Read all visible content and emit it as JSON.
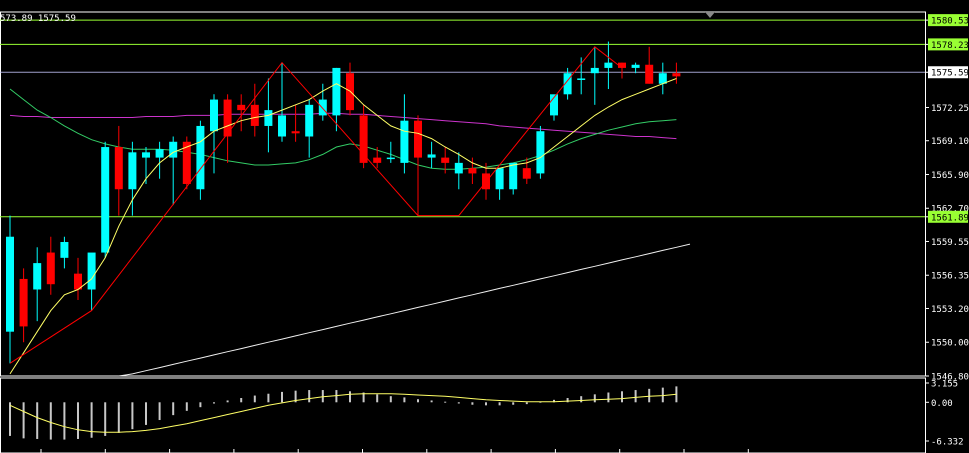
{
  "header": {
    "symbol_prices": "573.89 1575.59"
  },
  "colors": {
    "background": "#000000",
    "bull": "#00ffff",
    "bear": "#ff0000",
    "ma_fast": "#ffff66",
    "ma_mid": "#33cc66",
    "ma_slow": "#cc33cc",
    "ma_long": "#f0f0f0",
    "hline": "#99ff33",
    "zigzag": "#ff0000",
    "current_line": "#c9c9ff"
  },
  "chart_data": {
    "type": "candlestick",
    "price_axis_ticks": [
      "1580.53",
      "1578.23",
      "1575.59",
      "1572.25",
      "1569.10",
      "1565.90",
      "1562.70",
      "1561.89",
      "1559.55",
      "1556.35",
      "1553.20",
      "1550.00",
      "1546.80"
    ],
    "ylim": [
      1546.8,
      1581.3
    ],
    "hlines": [
      {
        "value": 1580.53,
        "label": "1580.53"
      },
      {
        "value": 1578.23,
        "label": "1578.23"
      },
      {
        "value": 1561.89,
        "label": "1561.89"
      }
    ],
    "current_price": {
      "value": 1575.59,
      "label": "1575.59"
    },
    "ohlc": [
      [
        1551.0,
        1562.0,
        1548.0,
        1560.0
      ],
      [
        1556.0,
        1557.0,
        1550.0,
        1551.5
      ],
      [
        1555.0,
        1559.0,
        1552.0,
        1557.5
      ],
      [
        1558.5,
        1560.0,
        1554.5,
        1555.5
      ],
      [
        1558.0,
        1560.0,
        1557.0,
        1559.5
      ],
      [
        1556.5,
        1558.0,
        1554.0,
        1555.0
      ],
      [
        1555.0,
        1558.0,
        1553.0,
        1558.5
      ],
      [
        1558.5,
        1569.0,
        1558.0,
        1568.5
      ],
      [
        1568.5,
        1570.5,
        1562.0,
        1564.5
      ],
      [
        1564.5,
        1569.0,
        1562.0,
        1568.0
      ],
      [
        1567.5,
        1568.5,
        1565.0,
        1568.0
      ],
      [
        1567.5,
        1569.0,
        1565.5,
        1568.3
      ],
      [
        1567.5,
        1569.5,
        1563.0,
        1569.0
      ],
      [
        1569.0,
        1569.5,
        1564.5,
        1565.0
      ],
      [
        1564.5,
        1571.0,
        1563.5,
        1570.5
      ],
      [
        1570.0,
        1573.5,
        1566.0,
        1573.0
      ],
      [
        1573.0,
        1573.5,
        1567.0,
        1569.5
      ],
      [
        1572.5,
        1573.5,
        1570.0,
        1572.0
      ],
      [
        1572.5,
        1574.5,
        1569.5,
        1570.5
      ],
      [
        1570.5,
        1575.0,
        1568.0,
        1572.0
      ],
      [
        1569.5,
        1576.5,
        1569.0,
        1571.5
      ],
      [
        1570.0,
        1572.5,
        1569.0,
        1569.8
      ],
      [
        1569.5,
        1573.0,
        1567.5,
        1572.5
      ],
      [
        1571.5,
        1574.5,
        1571.0,
        1573.0
      ],
      [
        1571.5,
        1576.0,
        1570.0,
        1576.0
      ],
      [
        1575.5,
        1576.5,
        1571.5,
        1572.0
      ],
      [
        1571.5,
        1572.5,
        1566.5,
        1567.0
      ],
      [
        1567.5,
        1568.5,
        1566.5,
        1567.0
      ],
      [
        1567.5,
        1569.0,
        1567.0,
        1567.5
      ],
      [
        1567.0,
        1573.5,
        1566.0,
        1571.0
      ],
      [
        1571.0,
        1571.5,
        1562.0,
        1567.5
      ],
      [
        1567.5,
        1569.0,
        1566.5,
        1567.8
      ],
      [
        1567.5,
        1568.5,
        1566.0,
        1567.0
      ],
      [
        1566.0,
        1568.0,
        1564.5,
        1567.0
      ],
      [
        1566.5,
        1567.5,
        1565.0,
        1566.0
      ],
      [
        1566.0,
        1567.0,
        1563.5,
        1564.5
      ],
      [
        1564.5,
        1566.5,
        1563.5,
        1566.5
      ],
      [
        1564.5,
        1567.0,
        1564.0,
        1567.0
      ],
      [
        1566.5,
        1567.5,
        1565.0,
        1565.5
      ],
      [
        1566.0,
        1570.5,
        1565.5,
        1570.0
      ],
      [
        1571.5,
        1573.0,
        1571.0,
        1573.5
      ],
      [
        1573.5,
        1576.0,
        1573.0,
        1575.5
      ],
      [
        1575.0,
        1577.0,
        1573.5,
        1575.0
      ],
      [
        1575.5,
        1578.0,
        1572.5,
        1576.0
      ],
      [
        1576.0,
        1578.5,
        1574.0,
        1576.5
      ],
      [
        1576.5,
        1576.5,
        1575.0,
        1576.0
      ],
      [
        1576.0,
        1576.5,
        1575.5,
        1576.3
      ],
      [
        1576.3,
        1578.0,
        1574.5,
        1574.5
      ],
      [
        1574.5,
        1576.5,
        1573.5,
        1575.5
      ],
      [
        1575.5,
        1576.5,
        1574.5,
        1575.2
      ]
    ],
    "ma_fast": [
      1547.0,
      1549.0,
      1551.0,
      1553.0,
      1554.5,
      1555.0,
      1556.0,
      1558.0,
      1561.0,
      1563.5,
      1565.5,
      1567.0,
      1568.0,
      1568.5,
      1569.0,
      1570.0,
      1570.5,
      1571.0,
      1571.3,
      1571.5,
      1572.0,
      1572.5,
      1573.0,
      1573.8,
      1574.5,
      1573.8,
      1572.5,
      1571.5,
      1570.5,
      1570.0,
      1569.8,
      1569.3,
      1568.5,
      1567.8,
      1567.0,
      1566.5,
      1566.5,
      1566.8,
      1567.0,
      1567.5,
      1568.5,
      1569.5,
      1570.5,
      1571.5,
      1572.3,
      1573.0,
      1573.5,
      1574.0,
      1574.5,
      1575.0
    ],
    "ma_mid": [
      1574.0,
      1573.0,
      1572.0,
      1571.3,
      1570.5,
      1569.8,
      1569.2,
      1568.8,
      1568.5,
      1568.3,
      1568.3,
      1568.3,
      1568.2,
      1568.0,
      1567.8,
      1567.5,
      1567.2,
      1567.0,
      1566.8,
      1566.8,
      1566.9,
      1567.0,
      1567.3,
      1567.8,
      1568.5,
      1568.8,
      1568.6,
      1568.2,
      1567.8,
      1567.3,
      1566.8,
      1566.5,
      1566.4,
      1566.4,
      1566.5,
      1566.6,
      1566.8,
      1567.0,
      1567.3,
      1567.7,
      1568.2,
      1568.8,
      1569.3,
      1569.7,
      1570.1,
      1570.4,
      1570.7,
      1570.9,
      1571.0,
      1571.1
    ],
    "ma_slow": [
      1571.5,
      1571.4,
      1571.4,
      1571.3,
      1571.3,
      1571.3,
      1571.3,
      1571.3,
      1571.3,
      1571.3,
      1571.4,
      1571.4,
      1571.4,
      1571.5,
      1571.5,
      1571.5,
      1571.6,
      1571.6,
      1571.6,
      1571.6,
      1571.6,
      1571.6,
      1571.6,
      1571.7,
      1571.7,
      1571.6,
      1571.6,
      1571.5,
      1571.4,
      1571.3,
      1571.2,
      1571.1,
      1571.0,
      1570.9,
      1570.8,
      1570.7,
      1570.5,
      1570.4,
      1570.3,
      1570.2,
      1570.1,
      1570.0,
      1569.9,
      1569.8,
      1569.7,
      1569.6,
      1569.5,
      1569.5,
      1569.4,
      1569.3
    ],
    "ma_long": {
      "start_index": 8,
      "values": [
        1546.8,
        1547.0,
        1547.3,
        1547.6,
        1547.9,
        1548.2,
        1548.5,
        1548.8,
        1549.1,
        1549.4,
        1549.7,
        1550.0,
        1550.3,
        1550.6,
        1550.9,
        1551.2,
        1551.5,
        1551.8,
        1552.1,
        1552.4,
        1552.7,
        1553.0,
        1553.3,
        1553.6,
        1553.9,
        1554.2,
        1554.5,
        1554.8,
        1555.1,
        1555.4,
        1555.7,
        1556.0,
        1556.3,
        1556.6,
        1556.9,
        1557.2,
        1557.5,
        1557.8,
        1558.1,
        1558.4,
        1558.7,
        1559.0,
        1559.3
      ]
    },
    "zigzag": [
      [
        0,
        1548.0
      ],
      [
        6,
        1553.0
      ],
      [
        20,
        1576.5
      ],
      [
        30,
        1562.0
      ],
      [
        33,
        1562.0
      ],
      [
        43,
        1578.0
      ],
      [
        45,
        1576.0
      ]
    ],
    "oscillator": {
      "ticks": [
        "3.155",
        "0.00",
        "-6.332"
      ],
      "ylim": [
        -6.332,
        3.155
      ],
      "histogram": [
        -5.5,
        -5.9,
        -6.0,
        -6.1,
        -6.1,
        -6.0,
        -5.8,
        -5.5,
        -5.0,
        -4.4,
        -3.7,
        -2.9,
        -2.1,
        -1.4,
        -0.8,
        -0.2,
        0.3,
        0.7,
        1.1,
        1.4,
        1.7,
        1.9,
        2.0,
        2.0,
        2.0,
        1.8,
        1.6,
        1.3,
        1.0,
        0.8,
        0.5,
        0.3,
        0.1,
        -0.2,
        -0.4,
        -0.5,
        -0.5,
        -0.4,
        -0.3,
        0.1,
        0.4,
        0.7,
        1.0,
        1.3,
        1.6,
        1.8,
        2.0,
        2.2,
        2.4,
        2.6
      ],
      "signal": [
        -0.5,
        -1.5,
        -2.5,
        -3.3,
        -4.0,
        -4.5,
        -4.8,
        -4.9,
        -4.9,
        -4.8,
        -4.6,
        -4.3,
        -3.9,
        -3.5,
        -3.0,
        -2.5,
        -2.0,
        -1.5,
        -1.0,
        -0.5,
        -0.1,
        0.3,
        0.6,
        0.9,
        1.1,
        1.3,
        1.4,
        1.4,
        1.4,
        1.3,
        1.2,
        1.1,
        1.0,
        0.8,
        0.6,
        0.4,
        0.3,
        0.2,
        0.1,
        0.1,
        0.1,
        0.2,
        0.3,
        0.4,
        0.5,
        0.6,
        0.8,
        1.0,
        1.1,
        1.3
      ]
    }
  }
}
